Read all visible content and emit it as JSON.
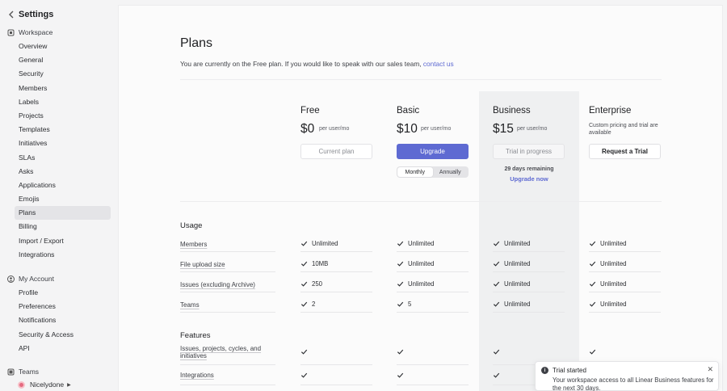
{
  "sidebar": {
    "title": "Settings",
    "workspace_label": "Workspace",
    "workspace_items": [
      {
        "label": "Overview"
      },
      {
        "label": "General"
      },
      {
        "label": "Security"
      },
      {
        "label": "Members"
      },
      {
        "label": "Labels"
      },
      {
        "label": "Projects"
      },
      {
        "label": "Templates"
      },
      {
        "label": "Initiatives"
      },
      {
        "label": "SLAs"
      },
      {
        "label": "Asks"
      },
      {
        "label": "Applications"
      },
      {
        "label": "Emojis"
      },
      {
        "label": "Plans",
        "active": true
      },
      {
        "label": "Billing"
      },
      {
        "label": "Import / Export"
      },
      {
        "label": "Integrations"
      }
    ],
    "account_label": "My Account",
    "account_items": [
      {
        "label": "Profile"
      },
      {
        "label": "Preferences"
      },
      {
        "label": "Notifications"
      },
      {
        "label": "Security & Access"
      },
      {
        "label": "API"
      }
    ],
    "teams_label": "Teams",
    "team_name": "Nicelydone"
  },
  "main": {
    "title": "Plans",
    "description": "You are currently on the Free plan. If you would like to speak with our sales team, ",
    "contact_link": "contact us",
    "plans": [
      {
        "name": "Free",
        "price": "$0",
        "per": "per user/mo",
        "button": "Current plan"
      },
      {
        "name": "Basic",
        "price": "$10",
        "per": "per user/mo",
        "button": "Upgrade"
      },
      {
        "name": "Business",
        "price": "$15",
        "per": "per user/mo",
        "button": "Trial in progress"
      },
      {
        "name": "Enterprise",
        "note": "Custom pricing and trial are available",
        "button": "Request a Trial"
      }
    ],
    "billing_toggle": {
      "monthly": "Monthly",
      "annually": "Annually",
      "selected": "Monthly"
    },
    "trial_days": "29 days remaining",
    "upgrade_now": "Upgrade now",
    "usage": {
      "title": "Usage",
      "rows": [
        {
          "label": "Members",
          "values": [
            "Unlimited",
            "Unlimited",
            "Unlimited",
            "Unlimited"
          ]
        },
        {
          "label": "File upload size",
          "values": [
            "10MB",
            "Unlimited",
            "Unlimited",
            "Unlimited"
          ]
        },
        {
          "label": "Issues (excluding Archive)",
          "values": [
            "250",
            "Unlimited",
            "Unlimited",
            "Unlimited"
          ]
        },
        {
          "label": "Teams",
          "values": [
            "2",
            "5",
            "Unlimited",
            "Unlimited"
          ]
        }
      ]
    },
    "features": {
      "title": "Features",
      "rows": [
        {
          "label": "Issues, projects, cycles, and initiatives"
        },
        {
          "label": "Integrations"
        }
      ]
    }
  },
  "toast": {
    "title": "Trial started",
    "body": "Your workspace access to all Linear Business features for the next 30 days."
  },
  "colors": {
    "accent": "#5e6ad2",
    "sidebar_bg": "#f4f4f5",
    "business_col": "#eff0f1"
  }
}
